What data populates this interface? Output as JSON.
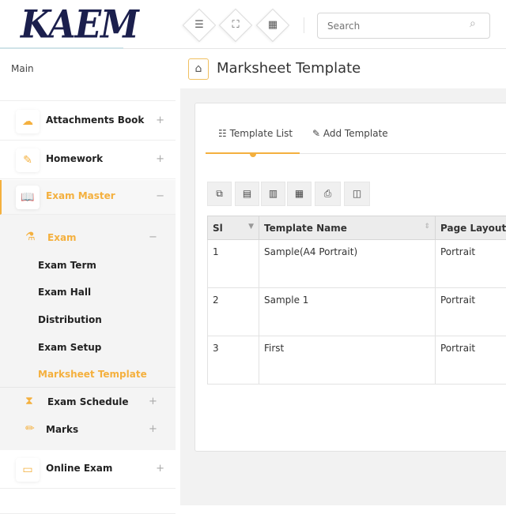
{
  "header": {
    "logo": "KAEM",
    "search_placeholder": "Search"
  },
  "sidebar": {
    "section": "Main",
    "items": [
      {
        "label": "Attachments Book",
        "toggle": "+"
      },
      {
        "label": "Homework",
        "toggle": "+"
      },
      {
        "label": "Exam Master",
        "toggle": "−"
      },
      {
        "label": "Online Exam",
        "toggle": "+"
      }
    ],
    "submenu": {
      "exam": {
        "label": "Exam",
        "toggle": "−"
      },
      "children": [
        "Exam Term",
        "Exam Hall",
        "Distribution",
        "Exam Setup",
        "Marksheet Template"
      ],
      "schedule": {
        "label": "Exam Schedule",
        "toggle": "+"
      },
      "marks": {
        "label": "Marks",
        "toggle": "+"
      }
    }
  },
  "page": {
    "title": "Marksheet Template",
    "tabs": [
      "Template List",
      "Add Template"
    ]
  },
  "table": {
    "columns": [
      "Sl",
      "Template Name",
      "Page Layout"
    ],
    "rows": [
      [
        "1",
        "Sample(A4 Portrait)",
        "Portrait"
      ],
      [
        "2",
        "Sample 1",
        "Portrait"
      ],
      [
        "3",
        "First",
        "Portrait"
      ]
    ]
  },
  "colors": {
    "accent": "#f4b03e",
    "logo": "#1b1f4d"
  }
}
